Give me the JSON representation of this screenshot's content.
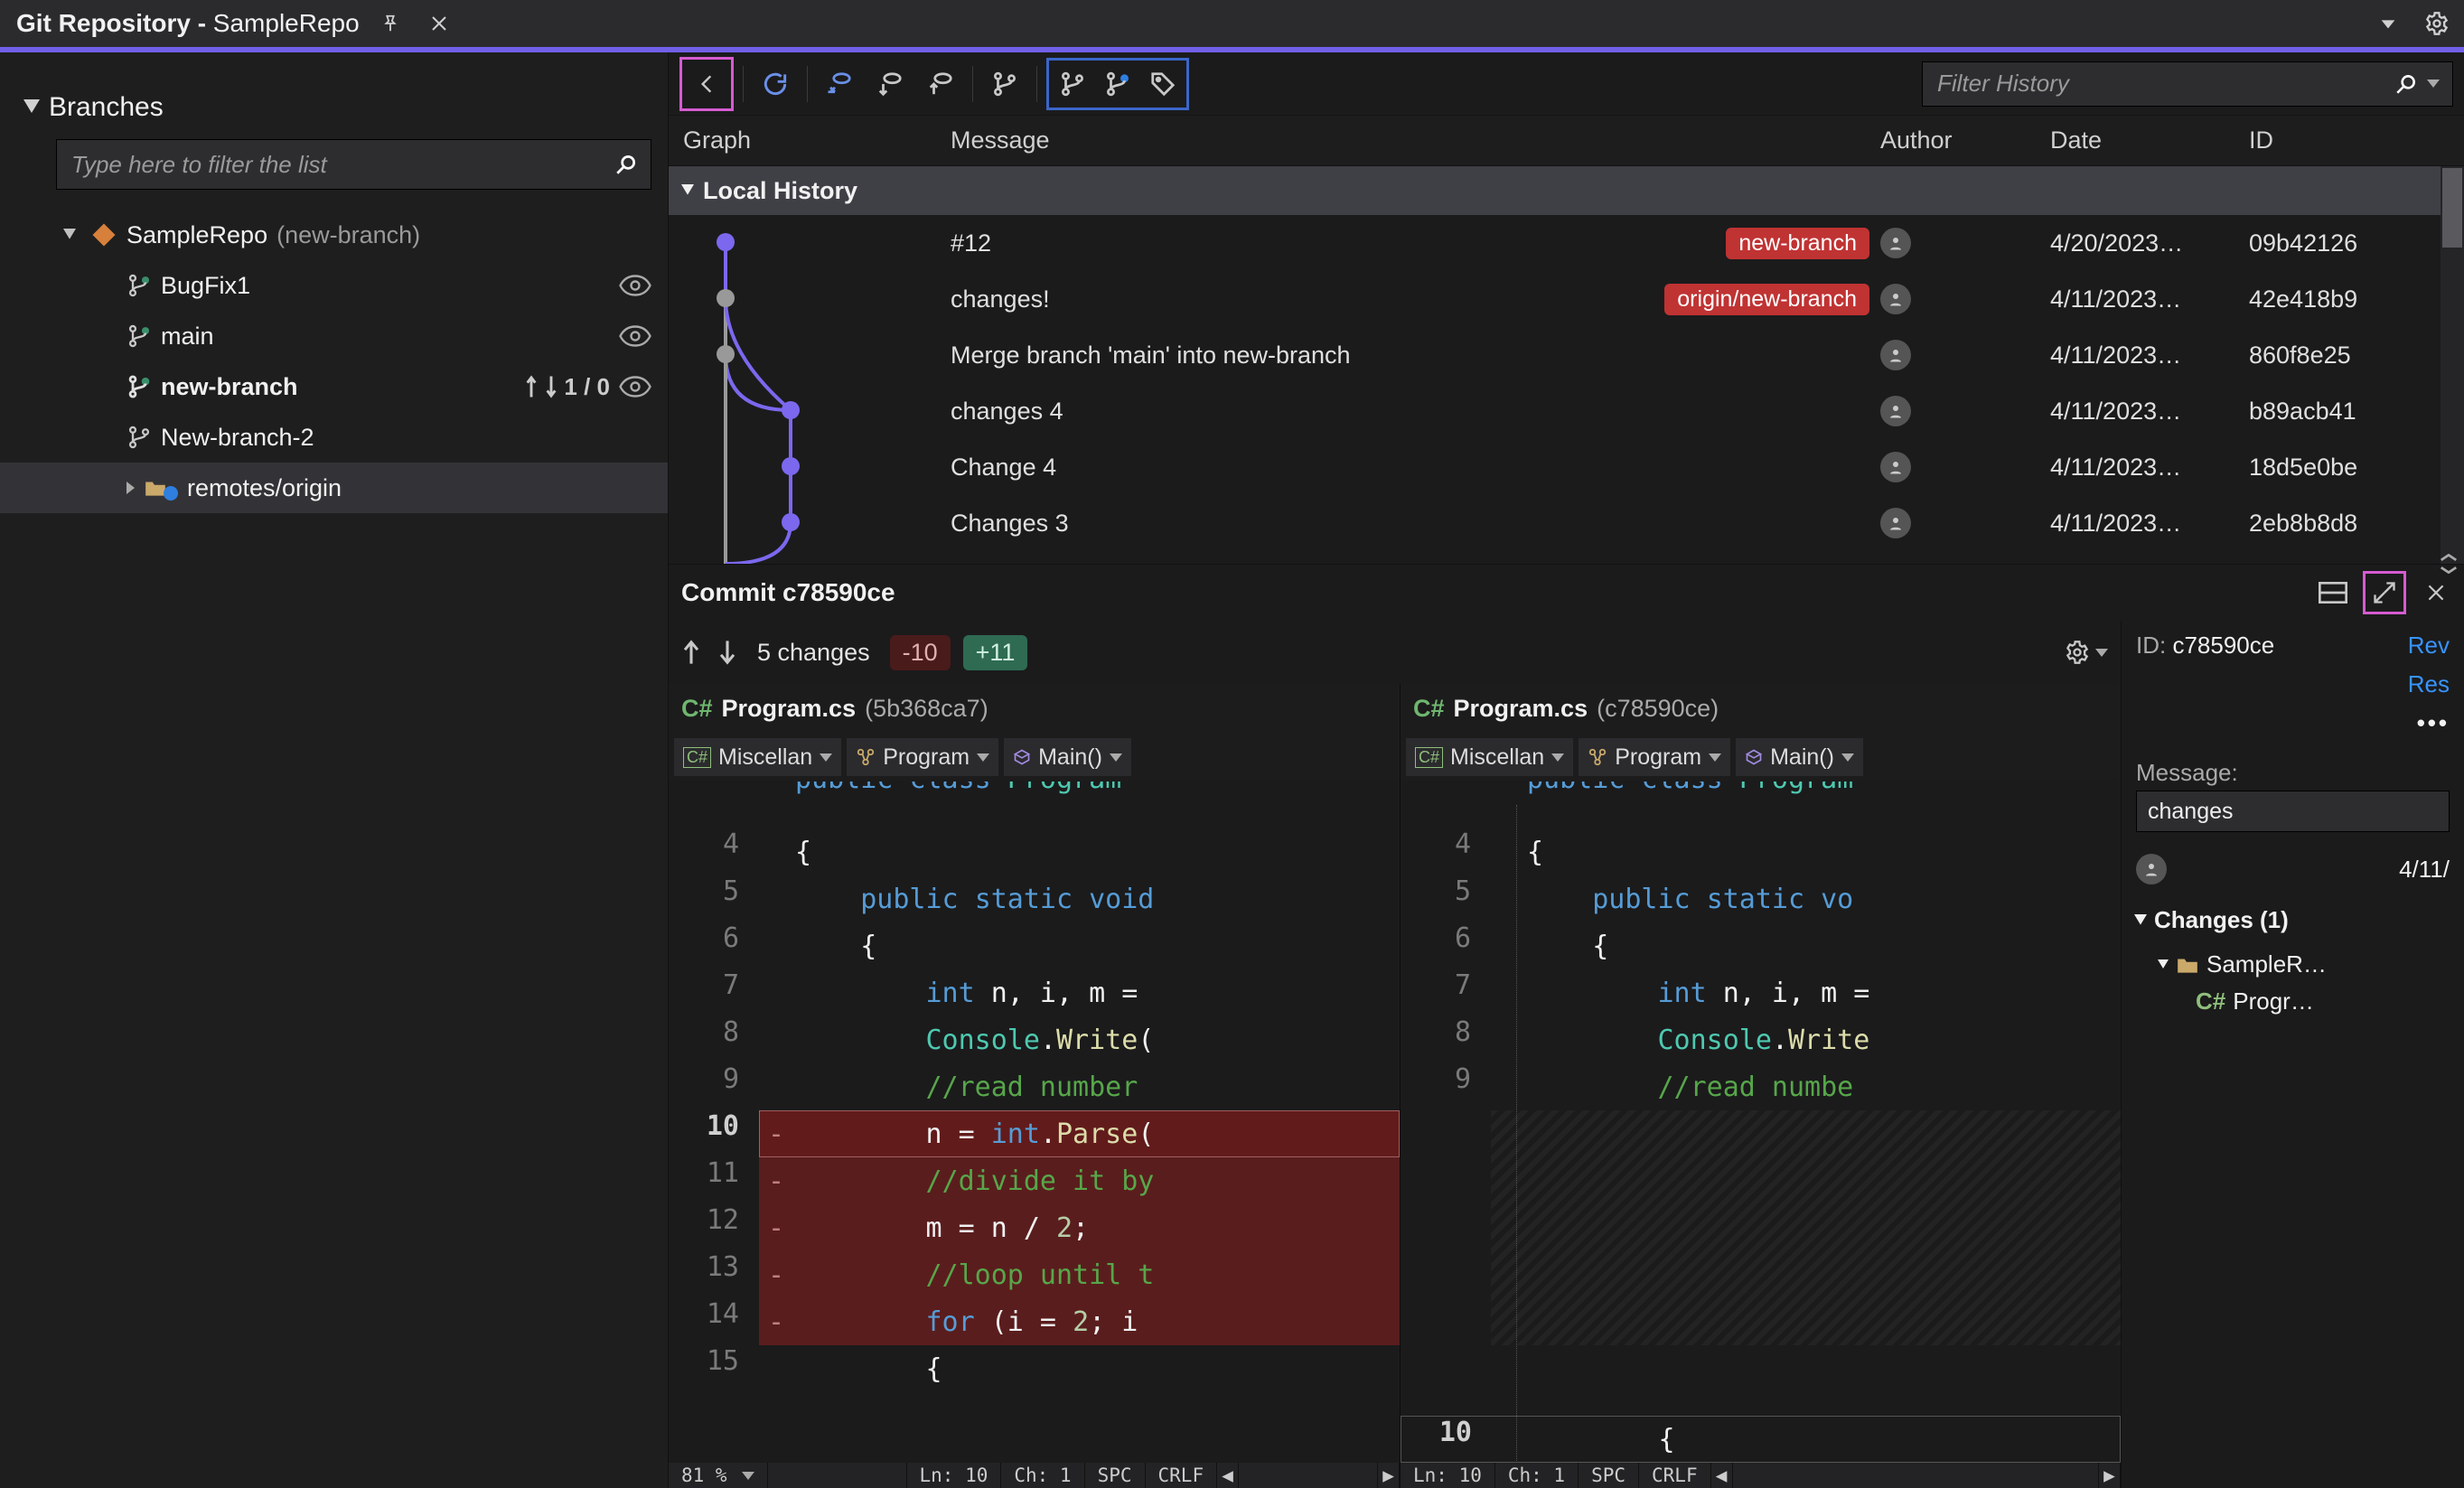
{
  "window": {
    "title_prefix": "Git Repository - ",
    "title_repo": "SampleRepo"
  },
  "sidebar": {
    "header": "Branches",
    "filter_placeholder": "Type here to filter the list",
    "repo_name": "SampleRepo",
    "repo_current_branch": "(new-branch)",
    "branches": [
      {
        "name": "BugFix1",
        "bold": false,
        "tracked": true
      },
      {
        "name": "main",
        "bold": false,
        "tracked": true
      },
      {
        "name": "new-branch",
        "bold": true,
        "tracked": true,
        "ahead_behind": "1 / 0"
      },
      {
        "name": "New-branch-2",
        "bold": false,
        "tracked": false
      }
    ],
    "remotes_label": "remotes/origin"
  },
  "toolbar": {
    "filter_placeholder": "Filter History"
  },
  "history": {
    "columns": {
      "graph": "Graph",
      "message": "Message",
      "author": "Author",
      "date": "Date",
      "id": "ID"
    },
    "section": "Local History",
    "rows": [
      {
        "msg": "#12",
        "badge": "new-branch",
        "date": "4/20/2023…",
        "id": "09b42126"
      },
      {
        "msg": "changes!",
        "badge": "origin/new-branch",
        "date": "4/11/2023…",
        "id": "42e418b9"
      },
      {
        "msg": "Merge branch 'main' into new-branch",
        "date": "4/11/2023…",
        "id": "860f8e25"
      },
      {
        "msg": "changes 4",
        "date": "4/11/2023…",
        "id": "b89acb41"
      },
      {
        "msg": "Change 4",
        "date": "4/11/2023…",
        "id": "18d5e0be"
      },
      {
        "msg": "Changes 3",
        "date": "4/11/2023…",
        "id": "2eb8b8d8"
      }
    ]
  },
  "commit": {
    "header": "Commit c78590ce",
    "changes_label": "5 changes",
    "removed": "-10",
    "added": "+11",
    "left": {
      "lang": "C#",
      "file": "Program.cs",
      "sha": "(5b368ca7)"
    },
    "right": {
      "lang": "C#",
      "file": "Program.cs",
      "sha": "(c78590ce)"
    },
    "nav": {
      "a": "Miscellan",
      "b": "Program",
      "c": "Main()"
    },
    "statusbar": {
      "zoom": "81 %",
      "ln": "Ln: 10",
      "ch": "Ch: 1",
      "spc": "SPC",
      "enc": "CRLF"
    },
    "statusbar_r": {
      "ln": "Ln: 10",
      "ch": "Ch: 1",
      "spc": "SPC",
      "enc": "CRLF"
    }
  },
  "details": {
    "id_label": "ID:",
    "id_value": "c78590ce",
    "link_rev": "Rev",
    "link_res": "Res",
    "message_label": "Message:",
    "message_value": "changes",
    "date": "4/11/",
    "changes_header": "Changes (1)",
    "folder": "SampleR…",
    "file_lang": "C#",
    "file": "Progr…"
  }
}
